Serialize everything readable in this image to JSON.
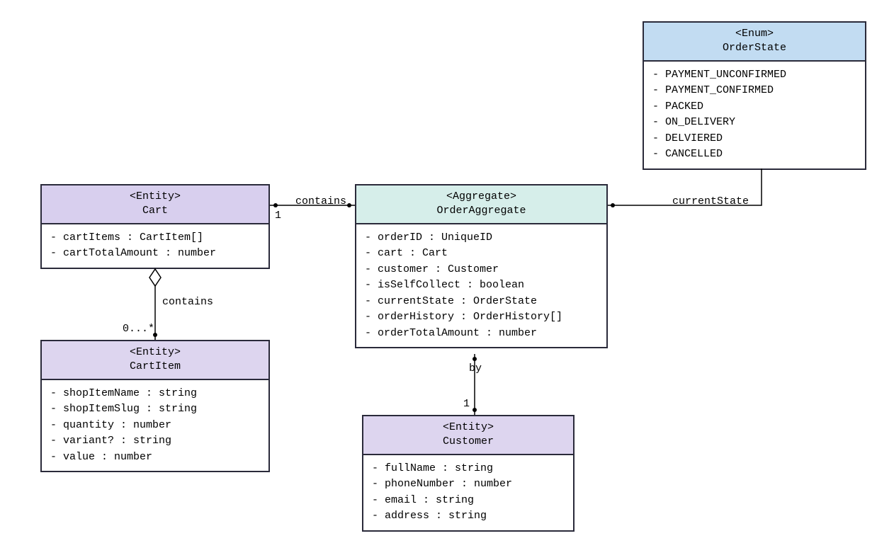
{
  "boxes": {
    "cart": {
      "stereotype": "<Entity>",
      "name": "Cart",
      "attrs": [
        "- cartItems : CartItem[]",
        "- cartTotalAmount : number"
      ]
    },
    "cartItem": {
      "stereotype": "<Entity>",
      "name": "CartItem",
      "attrs": [
        "- shopItemName : string",
        "- shopItemSlug : string",
        "- quantity : number",
        "- variant? : string",
        "- value : number"
      ]
    },
    "orderAggregate": {
      "stereotype": "<Aggregate>",
      "name": "OrderAggregate",
      "attrs": [
        "- orderID : UniqueID",
        "- cart : Cart",
        "- customer : Customer",
        "- isSelfCollect : boolean",
        "- currentState : OrderState",
        "- orderHistory : OrderHistory[]",
        "- orderTotalAmount : number"
      ]
    },
    "customer": {
      "stereotype": "<Entity>",
      "name": "Customer",
      "attrs": [
        "- fullName : string",
        "- phoneNumber : number",
        "- email : string",
        "- address : string"
      ]
    },
    "orderState": {
      "stereotype": "<Enum>",
      "name": "OrderState",
      "attrs": [
        "- PAYMENT_UNCONFIRMED",
        "- PAYMENT_CONFIRMED",
        "- PACKED",
        "- ON_DELIVERY",
        "- DELVIERED",
        "- CANCELLED"
      ]
    }
  },
  "edges": {
    "cart_order": {
      "label": "contains",
      "mult": "1"
    },
    "cart_cartItem": {
      "label": "contains",
      "mult": "0...*"
    },
    "order_customer": {
      "label": "by",
      "mult": "1"
    },
    "order_state": {
      "label": "currentState"
    }
  }
}
